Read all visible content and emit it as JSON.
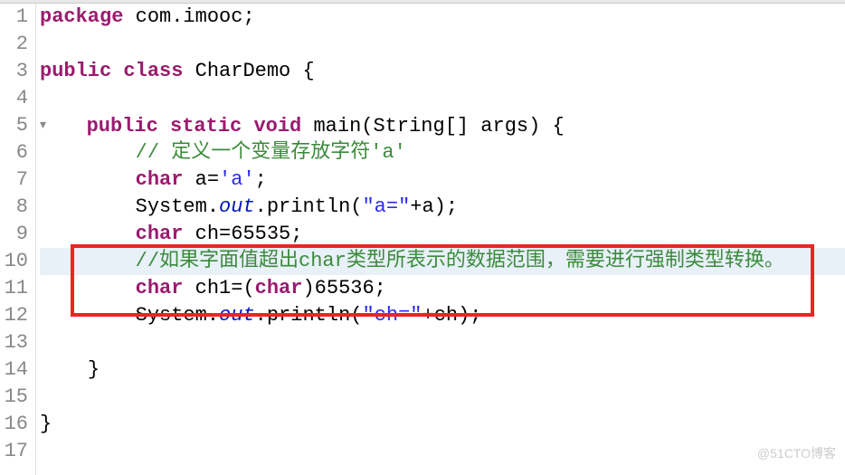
{
  "lines": [
    "1",
    "2",
    "3",
    "4",
    "5",
    "6",
    "7",
    "8",
    "9",
    "10",
    "11",
    "12",
    "13",
    "14",
    "15",
    "16",
    "17"
  ],
  "code": {
    "l1": {
      "kw1": "package",
      "pkg": " com.imooc;"
    },
    "l3": {
      "kw1": "public",
      "kw2": " class",
      "cls": " CharDemo ",
      "br": "{"
    },
    "l5": {
      "kw1": "public",
      "kw2": " static",
      "kw3": " void",
      "mtd": " main(String[] args) ",
      "br": "{"
    },
    "l6": {
      "cmt": "// 定义一个变量存放字符'a'"
    },
    "l7": {
      "type": "char",
      "txt": " a=",
      "str": "'a'",
      "semi": ";"
    },
    "l8": {
      "txt1": "System.",
      "stat": "out",
      "txt2": ".println(",
      "str": "\"a=\"",
      "txt3": "+a);"
    },
    "l9": {
      "type": "char",
      "txt": " ch=65535;"
    },
    "l10": {
      "cmt": "//如果字面值超出char类型所表示的数据范围，需要进行强制类型转换。"
    },
    "l11": {
      "type1": "char",
      "txt1": " ch1=(",
      "type2": "char",
      "txt2": ")65536;"
    },
    "l12": {
      "txt1": "System.",
      "stat": "out",
      "txt2": ".println(",
      "str": "\"ch=\"",
      "txt3": "+ch);"
    },
    "l14": {
      "br": "}"
    },
    "l16": {
      "br": "}"
    }
  },
  "watermark": "@51CTO博客"
}
